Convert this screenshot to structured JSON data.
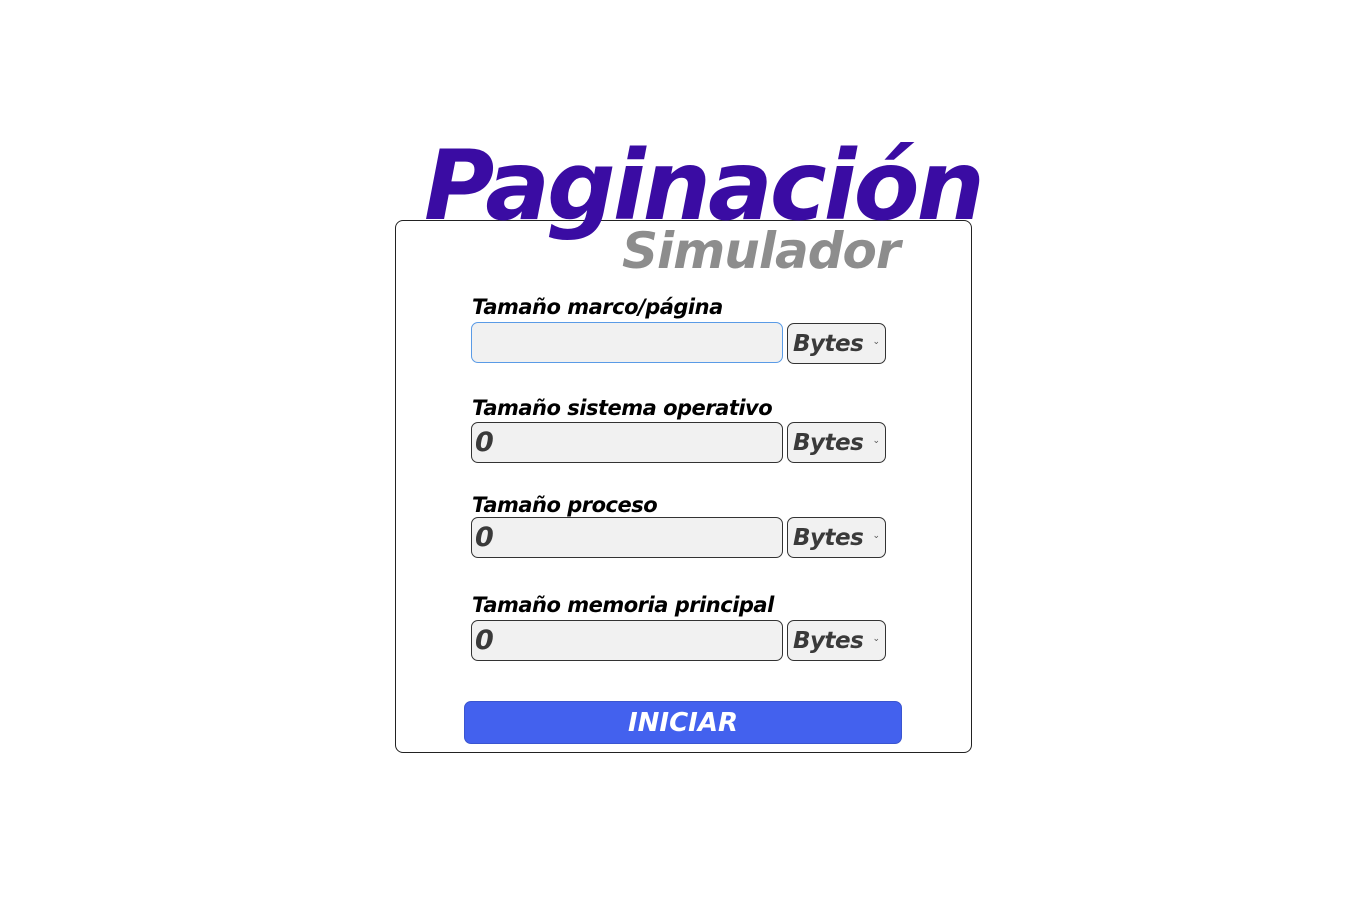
{
  "header": {
    "title": "Paginación",
    "subtitle": "Simulador"
  },
  "form": {
    "fields": [
      {
        "label": "Tamaño marco/página",
        "value": "",
        "unit": "Bytes"
      },
      {
        "label": "Tamaño sistema operativo",
        "value": "0",
        "unit": "Bytes"
      },
      {
        "label": "Tamaño proceso",
        "value": "0",
        "unit": "Bytes"
      },
      {
        "label": "Tamaño memoria principal",
        "value": "0",
        "unit": "Bytes"
      }
    ],
    "submit_label": "INICIAR"
  },
  "colors": {
    "title": "#3a0ca3",
    "subtitle": "#8d8d8d",
    "button": "#4361ee"
  }
}
